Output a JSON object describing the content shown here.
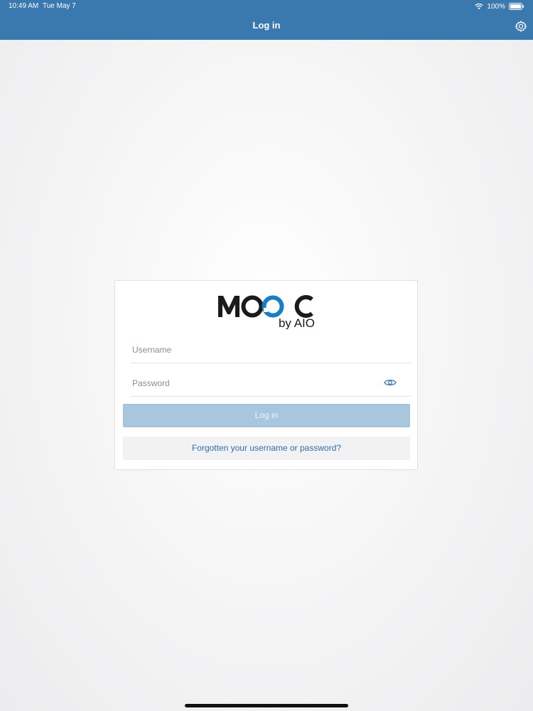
{
  "status_bar": {
    "time": "10:49 AM",
    "date": "Tue May 7",
    "battery": "100%"
  },
  "header": {
    "title": "Log in"
  },
  "logo": {
    "text": "MOOC",
    "subtext": "by AIO",
    "accent_color": "#1a7cc4"
  },
  "form": {
    "username_placeholder": "Username",
    "password_placeholder": "Password",
    "login_label": "Log in",
    "forgot_label": "Forgotten your username or password?"
  },
  "colors": {
    "header_bg": "#3a78b0",
    "button_disabled": "#a9c6df",
    "link": "#2f6fa8"
  }
}
